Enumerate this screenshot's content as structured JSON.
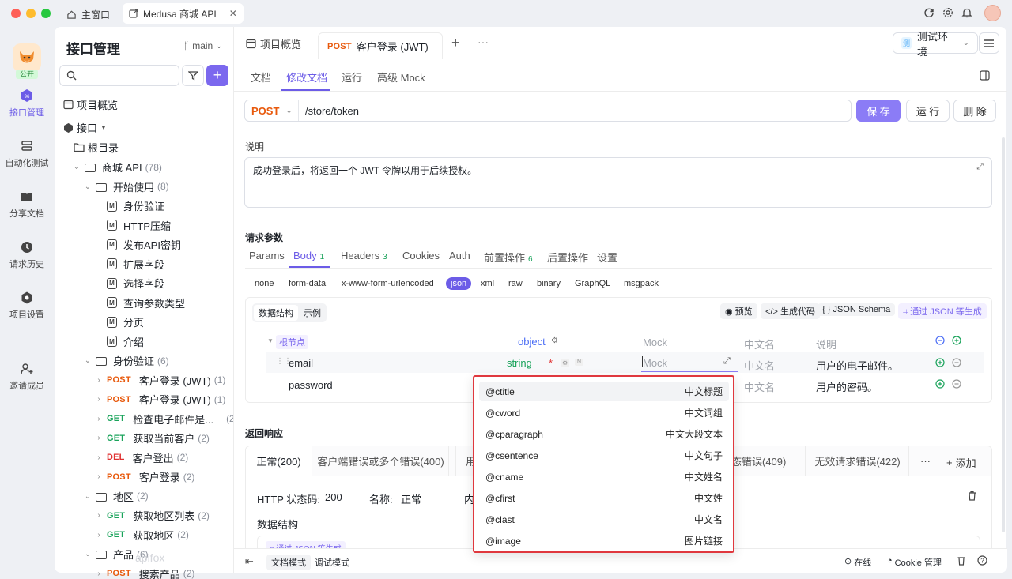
{
  "window": {
    "tabs": [
      {
        "label": "主窗口"
      },
      {
        "label": "Medusa 商城 API"
      }
    ]
  },
  "rail": {
    "avatar_label": "公开",
    "items": [
      {
        "label": "接口管理",
        "icon": "api-icon"
      },
      {
        "label": "自动化测试",
        "icon": "automation-icon"
      },
      {
        "label": "分享文档",
        "icon": "book-icon"
      },
      {
        "label": "请求历史",
        "icon": "history-icon"
      },
      {
        "label": "项目设置",
        "icon": "settings-icon"
      },
      {
        "label": "邀请成员",
        "icon": "user-plus-icon"
      }
    ]
  },
  "sidebar": {
    "title": "接口管理",
    "branch": "main",
    "search_placeholder": "",
    "overview": "项目概览",
    "api_root": "接口",
    "root_dir": "根目录",
    "tree": [
      {
        "label": "商城 API",
        "count": "(78)",
        "type": "folder",
        "level": 1
      },
      {
        "label": "开始使用",
        "count": "(8)",
        "type": "folder",
        "level": 2
      },
      {
        "label": "身份验证",
        "type": "doc",
        "level": 3
      },
      {
        "label": "HTTP压缩",
        "type": "doc",
        "level": 3
      },
      {
        "label": "发布API密钥",
        "type": "doc",
        "level": 3
      },
      {
        "label": "扩展字段",
        "type": "doc",
        "level": 3
      },
      {
        "label": "选择字段",
        "type": "doc",
        "level": 3
      },
      {
        "label": "查询参数类型",
        "type": "doc",
        "level": 3
      },
      {
        "label": "分页",
        "type": "doc",
        "level": 3
      },
      {
        "label": "介绍",
        "type": "doc",
        "level": 3
      },
      {
        "label": "身份验证",
        "count": "(6)",
        "type": "folder",
        "level": 2
      },
      {
        "method": "POST",
        "label": "客户登录 (JWT)",
        "count": "(1)",
        "type": "api",
        "level": 3
      },
      {
        "method": "POST",
        "label": "客户登录 (JWT)",
        "count": "(1)",
        "type": "api",
        "level": 3
      },
      {
        "method": "GET",
        "label": "检查电子邮件是...",
        "count": "(2)",
        "type": "api",
        "level": 3
      },
      {
        "method": "GET",
        "label": "获取当前客户",
        "count": "(2)",
        "type": "api",
        "level": 3
      },
      {
        "method": "DEL",
        "label": "客户登出",
        "count": "(2)",
        "type": "api",
        "level": 3
      },
      {
        "method": "POST",
        "label": "客户登录",
        "count": "(2)",
        "type": "api",
        "level": 3
      },
      {
        "label": "地区",
        "count": "(2)",
        "type": "folder",
        "level": 2
      },
      {
        "method": "GET",
        "label": "获取地区列表",
        "count": "(2)",
        "type": "api",
        "level": 3
      },
      {
        "method": "GET",
        "label": "获取地区",
        "count": "(2)",
        "type": "api",
        "level": 3
      },
      {
        "label": "产品",
        "count": "(6)",
        "type": "folder",
        "level": 2
      },
      {
        "method": "POST",
        "label": "搜索产品",
        "count": "(2)",
        "type": "api",
        "level": 3
      }
    ],
    "watermark": "apifox"
  },
  "header": {
    "tabs": [
      {
        "label": "项目概览"
      },
      {
        "method": "POST",
        "label": "客户登录 (JWT)"
      }
    ],
    "env": "测试环境",
    "env_badge": "测"
  },
  "subnav": {
    "tabs": [
      "文档",
      "修改文档",
      "运行",
      "高级 Mock"
    ],
    "active": 1
  },
  "request": {
    "method": "POST",
    "path": "/store/token",
    "save": "保 存",
    "run": "运 行",
    "delete": "删 除"
  },
  "description": {
    "label": "说明",
    "text": "成功登录后，将返回一个 JWT 令牌以用于后续授权。"
  },
  "params": {
    "title": "请求参数",
    "tabs": [
      {
        "label": "Params"
      },
      {
        "label": "Body",
        "badge": "1"
      },
      {
        "label": "Headers",
        "badge": "3"
      },
      {
        "label": "Cookies"
      },
      {
        "label": "Auth"
      },
      {
        "label": "前置操作",
        "badge": "6"
      },
      {
        "label": "后置操作"
      },
      {
        "label": "设置"
      }
    ],
    "body_types": [
      "none",
      "form-data",
      "x-www-form-urlencoded",
      "json",
      "xml",
      "raw",
      "binary",
      "GraphQL",
      "msgpack"
    ],
    "schema_tabs": [
      "数据结构",
      "示例"
    ],
    "tools": [
      "预览",
      "生成代码",
      "JSON Schema",
      "通过 JSON 等生成"
    ],
    "root": {
      "name": "根节点",
      "type": "object",
      "mock": "Mock",
      "cn": "中文名",
      "desc": "说明"
    },
    "fields": [
      {
        "name": "email",
        "type": "string",
        "required": "*",
        "mock": "Mock",
        "cn": "中文名",
        "desc": "用户的电子邮件。"
      },
      {
        "name": "password",
        "type": "",
        "mock": "",
        "cn": "中文名",
        "desc": "用户的密码。"
      }
    ]
  },
  "mock_dropdown": [
    {
      "key": "@ctitle",
      "label": "中文标题"
    },
    {
      "key": "@cword",
      "label": "中文词组"
    },
    {
      "key": "@cparagraph",
      "label": "中文大段文本"
    },
    {
      "key": "@csentence",
      "label": "中文句子"
    },
    {
      "key": "@cname",
      "label": "中文姓名"
    },
    {
      "key": "@cfirst",
      "label": "中文姓"
    },
    {
      "key": "@clast",
      "label": "中文名"
    },
    {
      "key": "@image",
      "label": "图片链接"
    }
  ],
  "response": {
    "title": "返回响应",
    "tabs": [
      "正常(200)",
      "客户端错误或多个错误(400)",
      "用",
      "态错误(409)",
      "无效请求错误(422)"
    ],
    "more": "···",
    "add": "添加",
    "status_label": "HTTP 状态码:",
    "status": "200",
    "name_label": "名称:",
    "name": "正常",
    "content_label": "内",
    "schema_label": "数据结构",
    "gen_hint": "通过 JSON 等生成"
  },
  "footer": {
    "modes": [
      "文档模式",
      "调试模式"
    ],
    "online": "在线",
    "cookie": "Cookie 管理"
  },
  "colors": {
    "accent": "#6c5ce7",
    "post": "#e8590c",
    "get": "#1aa35b",
    "del": "#e03131",
    "highlight_border": "#e0383e"
  }
}
